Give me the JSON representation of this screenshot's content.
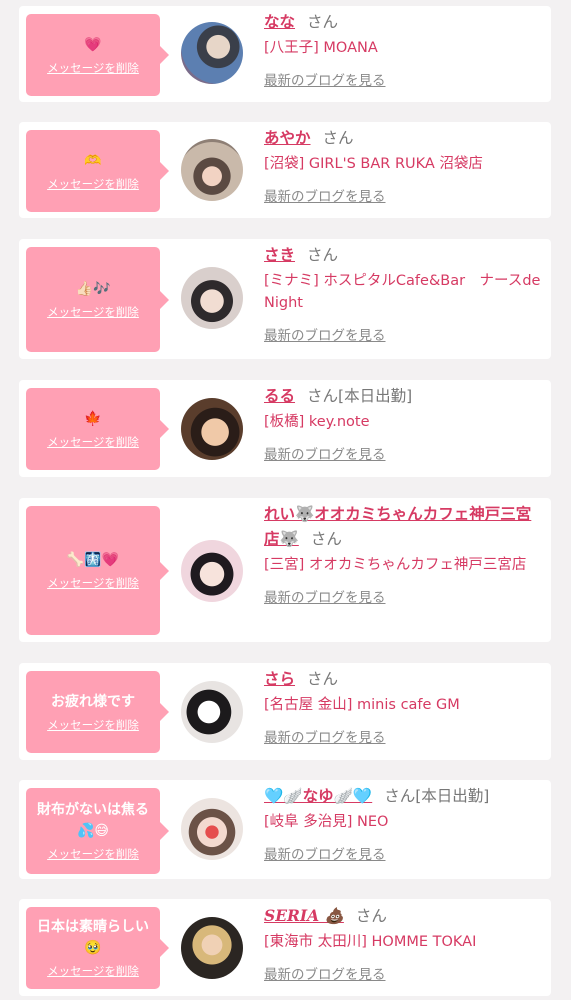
{
  "colors": {
    "accent": "#d63a63",
    "bubble": "#ffa0b4",
    "bg": "#f3f1f2"
  },
  "items": [
    {
      "message": "💗",
      "delete_label": "メッセージを削除",
      "name": "なな",
      "san": "さん",
      "status": "",
      "shop": "[八王子] MOANA",
      "blog_label": "最新のブログを見る"
    },
    {
      "message": "🫶",
      "delete_label": "メッセージを削除",
      "name": "あやか",
      "san": "さん",
      "status": "",
      "shop": "[沼袋] GIRL'S BAR RUKA 沼袋店",
      "blog_label": "最新のブログを見る"
    },
    {
      "message": "👍🏻🎶",
      "delete_label": "メッセージを削除",
      "name": "さき",
      "san": "さん",
      "status": "",
      "shop": "[ミナミ] ホスピタルCafe&Bar　ナースde Night",
      "blog_label": "最新のブログを見る"
    },
    {
      "message": "🍁",
      "delete_label": "メッセージを削除",
      "name": "るる",
      "san": "さん",
      "status": "[本日出勤]",
      "shop": "[板橋] key.note",
      "blog_label": "最新のブログを見る"
    },
    {
      "message": "🦴🩻💗",
      "delete_label": "メッセージを削除",
      "name": "れい🐺オオカミちゃんカフェ神戸三宮店🐺",
      "san": "さん",
      "status": "",
      "shop": "[三宮] オオカミちゃんカフェ神戸三宮店",
      "blog_label": "最新のブログを見る"
    },
    {
      "message": "お疲れ様です",
      "delete_label": "メッセージを削除",
      "name": "さら",
      "san": "さん",
      "status": "",
      "shop": "[名古屋 金山] minis cafe GM",
      "blog_label": "最新のブログを見る"
    },
    {
      "message": "財布がないは焦る💦😅",
      "delete_label": "メッセージを削除",
      "name": "🩵🪽なゆ🪽🩵",
      "san": "さん",
      "status": "[本日出勤]",
      "shop": "[岐阜 多治見] NEO",
      "blog_label": "最新のブログを見る"
    },
    {
      "message": "日本は素晴らしい🥹",
      "delete_label": "メッセージを削除",
      "name": "SERIA 💩",
      "san": "さん",
      "status": "",
      "shop": "[東海市 太田川] HOMME TOKAI",
      "blog_label": "最新のブログを見る"
    }
  ]
}
